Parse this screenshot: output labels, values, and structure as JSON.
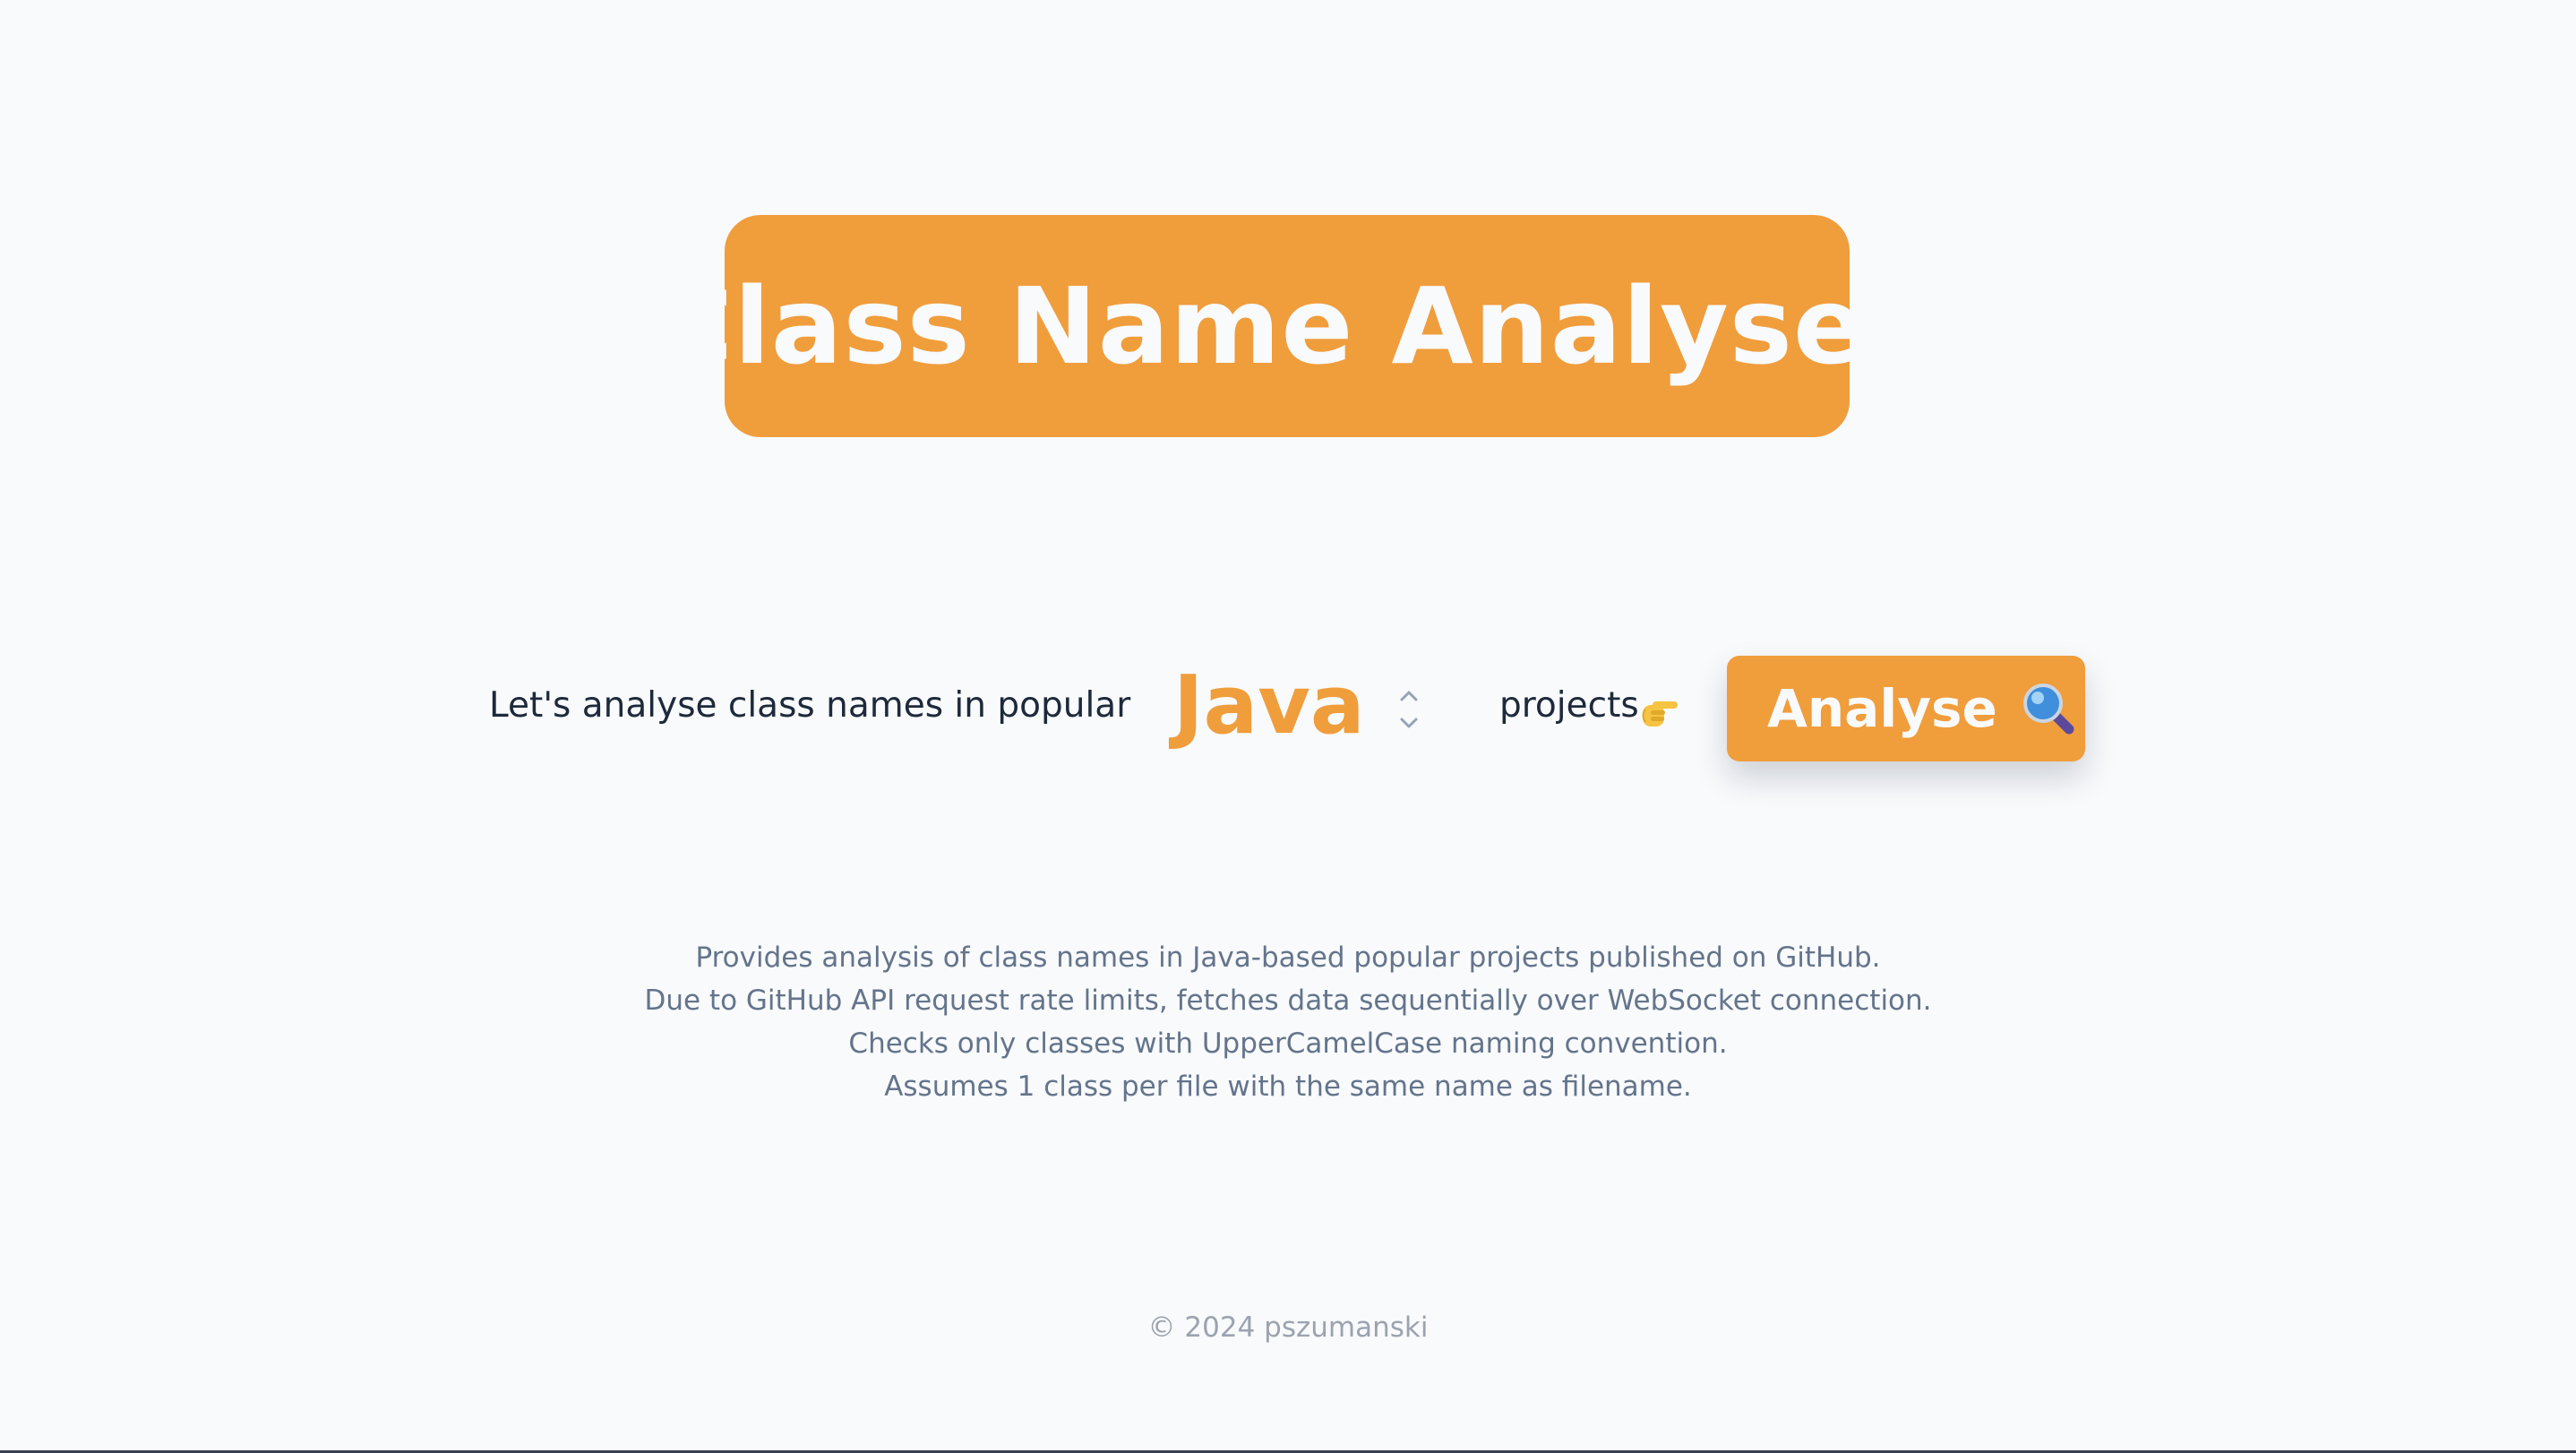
{
  "app": {
    "title": "Class Name Analyser"
  },
  "controls": {
    "lead_text": "Let's analyse class names in popular",
    "language_selected": "Java",
    "trailing_text": "projects",
    "hand_icon": "backhand-index-pointing-right-icon",
    "analyse_label": "Analyse",
    "analyse_icon": "magnifier-icon"
  },
  "description": {
    "lines": [
      "Provides analysis of class names in Java-based popular projects published on GitHub.",
      "Due to GitHub API request rate limits, fetches data sequentially over WebSocket connection.",
      "Checks only classes with UpperCamelCase naming convention.",
      "Assumes 1 class per file with the same name as filename."
    ]
  },
  "footer": {
    "text": "© 2024 pszumanski"
  },
  "colors": {
    "accent": "#f09d3c",
    "background": "#f8fafc",
    "body_text": "#1e293b",
    "muted_text": "#64748b",
    "footer_text": "#9ca3af"
  }
}
